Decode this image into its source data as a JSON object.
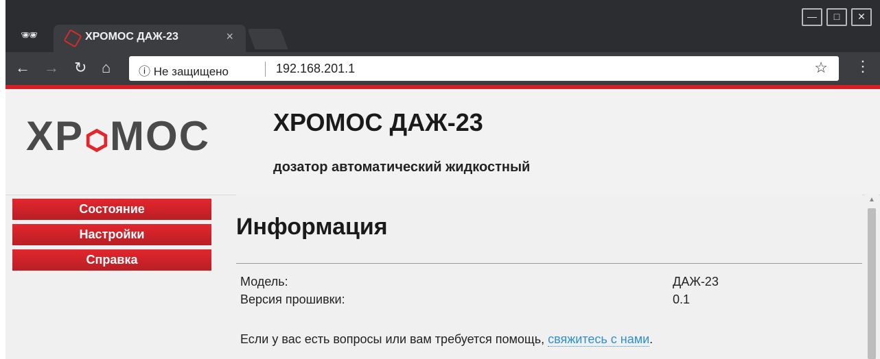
{
  "browser": {
    "tab_title": "ХРОМОС ДАЖ-23",
    "tab_close": "×",
    "security_label": "ⓘ Не защищено",
    "url": "192.168.201.1"
  },
  "site": {
    "logo_text_left": "ХР",
    "logo_text_right": "МОС",
    "title": "ХРОМОС ДАЖ-23",
    "subtitle": "дозатор автоматический жидкостный"
  },
  "sidebar": {
    "items": [
      {
        "label": "Состояние"
      },
      {
        "label": "Настройки"
      },
      {
        "label": "Справка"
      }
    ]
  },
  "content": {
    "heading": "Информация",
    "rows": [
      {
        "label": "Модель:",
        "value": "ДАЖ-23"
      },
      {
        "label": "Версия прошивки:",
        "value": "0.1"
      }
    ],
    "help_prefix": "Если у вас есть вопросы или вам требуется помощь, ",
    "help_link": "свяжитесь с нами",
    "help_suffix": "."
  },
  "colors": {
    "accent": "#d42027",
    "link": "#2d8fd5"
  }
}
